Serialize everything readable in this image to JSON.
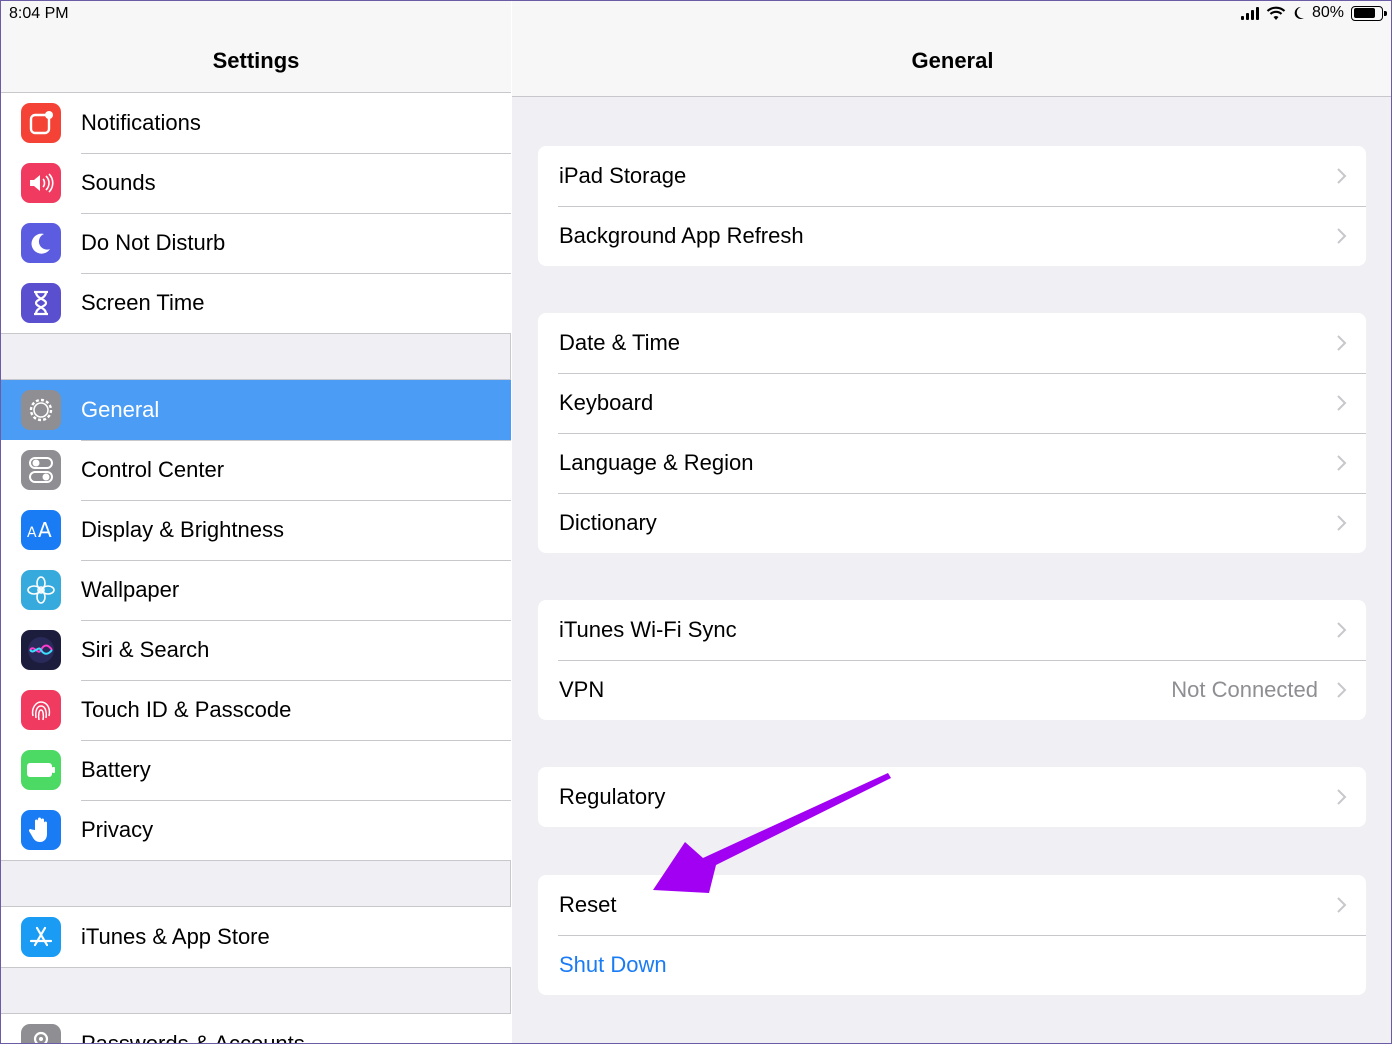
{
  "status_bar": {
    "time": "8:04 PM",
    "battery_percent": "80%",
    "battery_level": 0.8,
    "icons": [
      "signal-icon",
      "wifi-icon",
      "do-not-disturb-moon-icon",
      "battery-icon"
    ]
  },
  "sidebar": {
    "title": "Settings",
    "groups": [
      [
        {
          "label": "Notifications",
          "icon": "notifications-icon",
          "color": "#f44336"
        },
        {
          "label": "Sounds",
          "icon": "speaker-icon",
          "color": "#f03a5f"
        },
        {
          "label": "Do Not Disturb",
          "icon": "moon-icon",
          "color": "#5c5ce0"
        },
        {
          "label": "Screen Time",
          "icon": "hourglass-icon",
          "color": "#5a4fcf"
        }
      ],
      [
        {
          "label": "General",
          "icon": "gear-icon",
          "color": "#8e8e93",
          "selected": true
        },
        {
          "label": "Control Center",
          "icon": "toggles-icon",
          "color": "#8e8e93"
        },
        {
          "label": "Display & Brightness",
          "icon": "text-size-icon",
          "color": "#1a7cf4"
        },
        {
          "label": "Wallpaper",
          "icon": "flower-icon",
          "color": "#36aadc"
        },
        {
          "label": "Siri & Search",
          "icon": "siri-icon",
          "color": "#1c1c3c"
        },
        {
          "label": "Touch ID & Passcode",
          "icon": "fingerprint-icon",
          "color": "#f03a5f"
        },
        {
          "label": "Battery",
          "icon": "battery-icon",
          "color": "#4cd964"
        },
        {
          "label": "Privacy",
          "icon": "hand-icon",
          "color": "#1a7cf4"
        }
      ],
      [
        {
          "label": "iTunes & App Store",
          "icon": "app-store-icon",
          "color": "#1a9cf4"
        }
      ],
      [
        {
          "label": "Passwords & Accounts",
          "icon": "key-icon",
          "color": "#8e8e93"
        }
      ]
    ]
  },
  "detail": {
    "title": "General",
    "groups": [
      [
        {
          "label": "iPad Storage"
        },
        {
          "label": "Background App Refresh"
        }
      ],
      [
        {
          "label": "Date & Time"
        },
        {
          "label": "Keyboard"
        },
        {
          "label": "Language & Region"
        },
        {
          "label": "Dictionary"
        }
      ],
      [
        {
          "label": "iTunes Wi-Fi Sync"
        },
        {
          "label": "VPN",
          "value": "Not Connected"
        }
      ],
      [
        {
          "label": "Regulatory"
        }
      ],
      [
        {
          "label": "Reset"
        },
        {
          "label": "Shut Down",
          "link": true
        }
      ]
    ]
  },
  "annotation": {
    "arrow_color": "#a100f2",
    "target": "Reset"
  }
}
